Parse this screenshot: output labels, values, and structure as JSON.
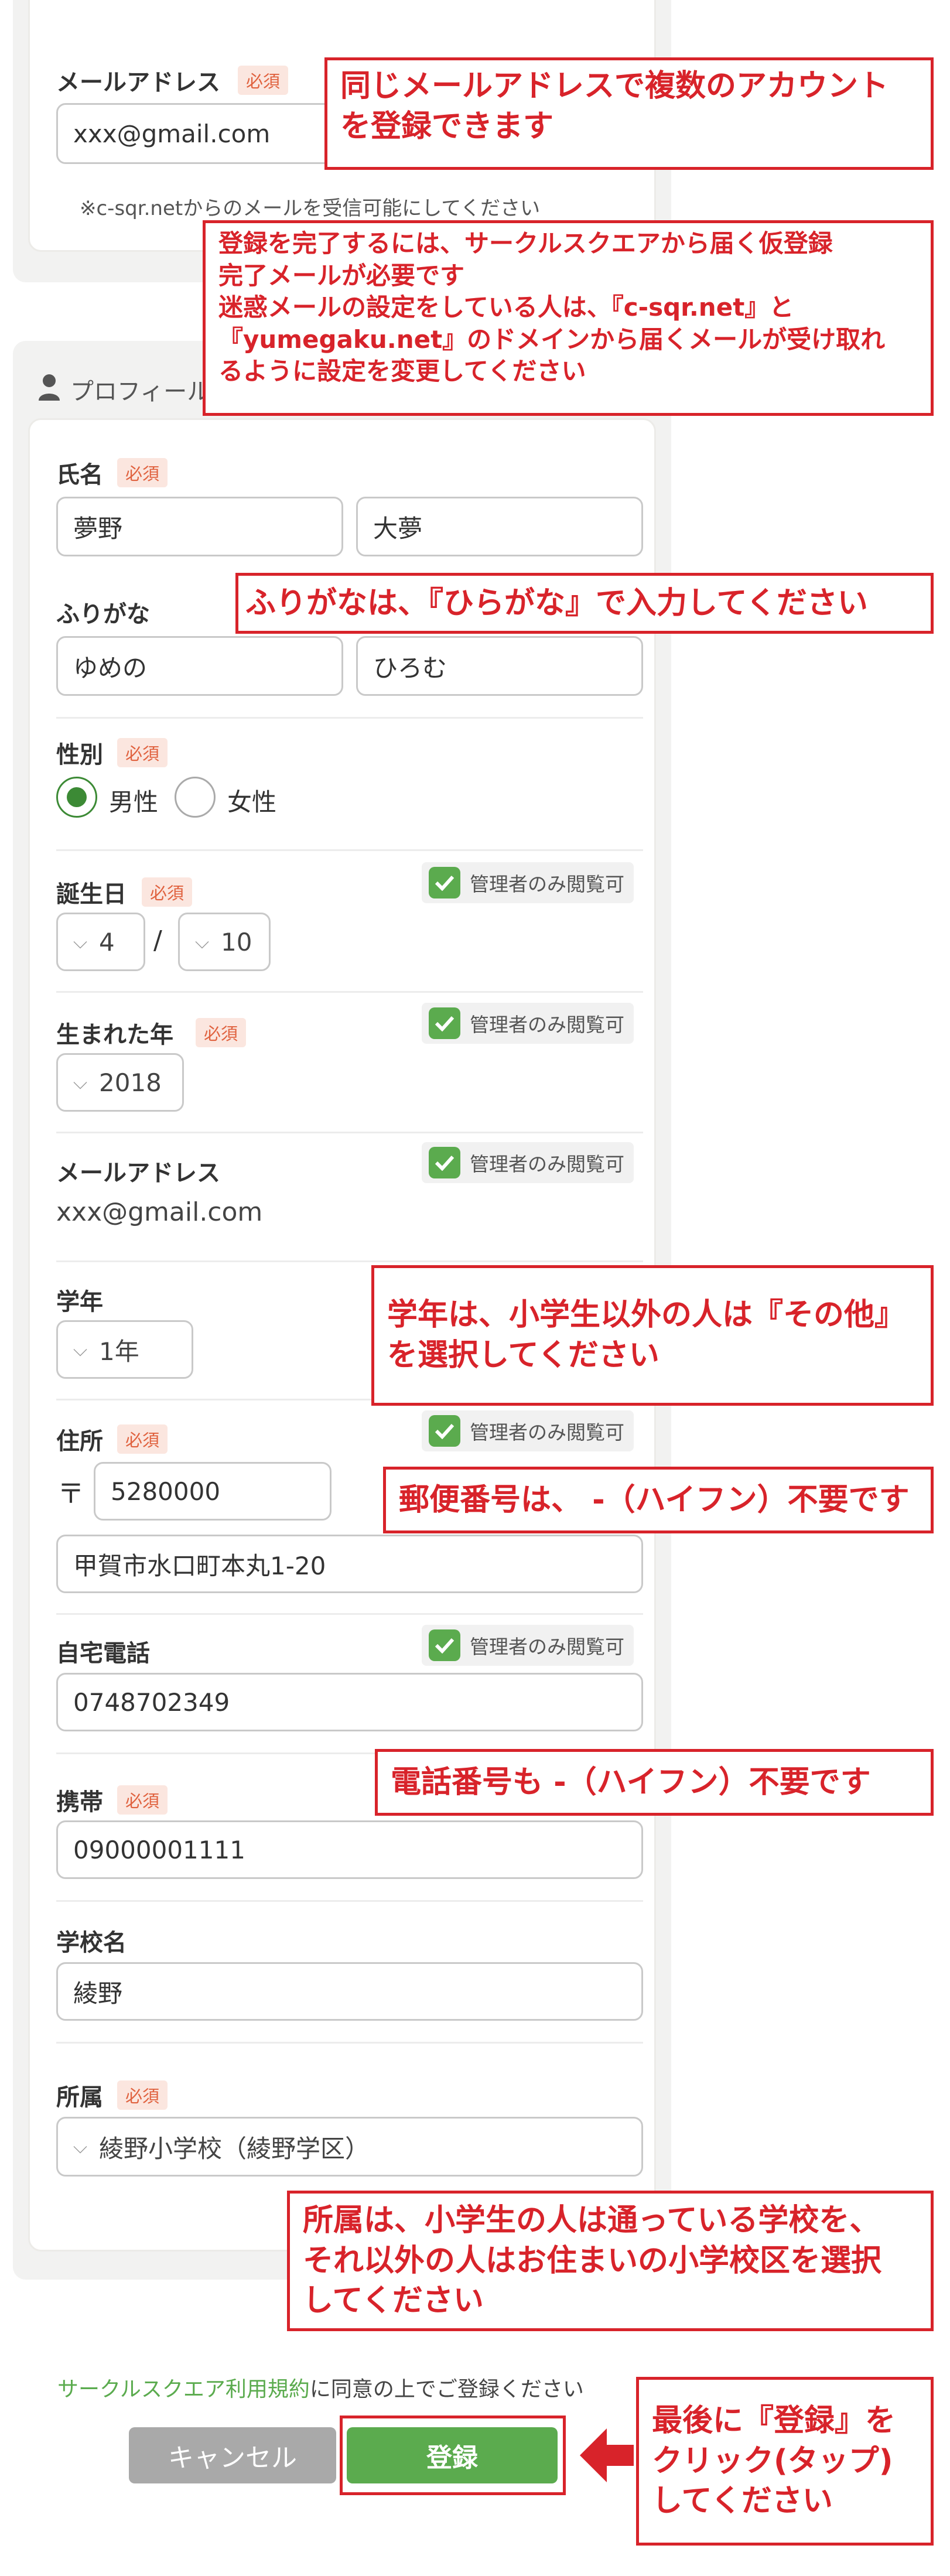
{
  "email_section": {
    "label": "メールアドレス",
    "required": "必須",
    "value": "xxx@gmail.com",
    "note": "※c-sqr.netからのメールを受信可能にしてください"
  },
  "profile_section": {
    "title": "プロフィール",
    "privacy_label": "管理者のみ閲覧可",
    "name": {
      "label": "氏名",
      "required": "必須",
      "last": "夢野",
      "first": "大夢"
    },
    "furigana": {
      "label": "ふりがな",
      "last": "ゆめの",
      "first": "ひろむ"
    },
    "gender": {
      "label": "性別",
      "required": "必須",
      "options": [
        "男性",
        "女性"
      ],
      "selected": "男性"
    },
    "birthday": {
      "label": "誕生日",
      "required": "必須",
      "month": "4",
      "separator": "/",
      "day": "10"
    },
    "birth_year": {
      "label": "生まれた年",
      "required": "必須",
      "value": "2018"
    },
    "email": {
      "label": "メールアドレス",
      "value": "xxx@gmail.com"
    },
    "grade": {
      "label": "学年",
      "value": "1年"
    },
    "address": {
      "label": "住所",
      "required": "必須",
      "postal_mark": "〒",
      "postal": "5280000",
      "street": "甲賀市水口町本丸1-20"
    },
    "home_phone": {
      "label": "自宅電話",
      "value": "0748702349"
    },
    "mobile": {
      "label": "携帯",
      "required": "必須",
      "value": "09000001111"
    },
    "school": {
      "label": "学校名",
      "value": "綾野"
    },
    "affiliation": {
      "label": "所属",
      "required": "必須",
      "value": "綾野小学校（綾野学区）"
    }
  },
  "footer": {
    "terms_link": "サークルスクエア利用規約",
    "terms_text": "に同意の上でご登録ください",
    "cancel": "キャンセル",
    "register": "登録"
  },
  "annotations": {
    "a1": [
      "同じメールアドレスで複数のアカウント",
      "を登録できます"
    ],
    "a2": [
      "登録を完了するには、サークルスクエアから届く仮登録",
      "完了メールが必要です",
      "迷惑メールの設定をしている人は、『c-sqr.net』と",
      "『yumegaku.net』のドメインから届くメールが受け取れ",
      "るように設定を変更してください"
    ],
    "a3": "ふりがなは、『ひらがな』で入力してください",
    "a4": [
      "学年は、小学生以外の人は『その他』",
      "を選択してください"
    ],
    "a5": "郵便番号は、 -（ハイフン）不要です",
    "a6": "電話番号も -（ハイフン）不要です",
    "a7": [
      "所属は、小学生の人は通っている学校を、",
      "それ以外の人はお住まいの小学校区を選択",
      "してください"
    ],
    "a8": [
      "最後に『登録』を",
      "クリック(タップ)",
      "してください"
    ]
  },
  "colors": {
    "accent_green": "#5bab4e",
    "annotation_red": "#d8232a",
    "required_red": "#e0623f"
  }
}
